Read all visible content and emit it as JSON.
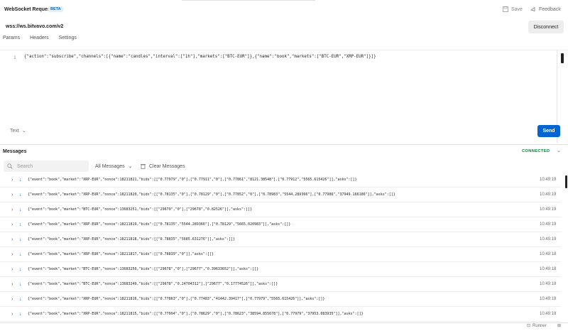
{
  "header": {
    "title": "WebSocket Request",
    "badge": "BETA",
    "save_label": "Save",
    "feedback_label": "Feedback"
  },
  "url_bar": {
    "url": "wss://ws.bitvavo.com/v2",
    "disconnect_label": "Disconnect"
  },
  "tabs": [
    {
      "label": "Params"
    },
    {
      "label": "Headers"
    },
    {
      "label": "Settings"
    }
  ],
  "editor": {
    "line_number": "1",
    "code": "{\"action\":\"subscribe\",\"channels\":[{\"name\":\"candles\",\"interval\":[\"1h\"],\"markets\":[\"BTC-EUR\"]},{\"name\":\"book\",\"markets\":[\"BTC-EUR\",\"XRP-EUR\"]}]}",
    "format_label": "Text",
    "send_label": "Send"
  },
  "messages_panel": {
    "title": "Messages",
    "status": "CONNECTED",
    "search_placeholder": "Search",
    "filter_label": "All Messages",
    "clear_label": "Clear Messages",
    "rows": [
      {
        "content": "{\"event\":\"book\",\"market\":\"XRP-EUR\",\"nonce\":18211821,\"bids\":[[\"0.77979\",\"0\"],[\"0.77911\",\"0\"],[\"0.77861\",\"8121.38548\"],[\"0.77912\",\"5565.615426\"]],\"asks\":[]}",
        "time": "10:49:19"
      },
      {
        "content": "{\"event\":\"book\",\"market\":\"XRP-EUR\",\"nonce\":18211820,\"bids\":[[\"0.78135\",\"0\"],[\"0.78129\",\"0\"],[\"0.77852\",\"0\"],[\"0.78983\",\"5544.289366\"],[\"0.77986\",\"37949.166186\"]],\"asks\":[]}",
        "time": "10:49:19"
      },
      {
        "content": "{\"event\":\"book\",\"market\":\"BTC-EUR\",\"nonce\":13683251,\"bids\":[[\"29679\",\"0\"],[\"29678\",\"0.82526\"]],\"asks\":[]}",
        "time": "10:49:19"
      },
      {
        "content": "{\"event\":\"book\",\"market\":\"XRP-EUR\",\"nonce\":18211819,\"bids\":[[\"0.78135\",\"5544.289366\"],[\"0.78129\",\"5665.020983\"]],\"asks\":[]}",
        "time": "10:49:19"
      },
      {
        "content": "{\"event\":\"book\",\"market\":\"XRP-EUR\",\"nonce\":18211818,\"bids\":[[\"0.78835\",\"5685.631276\"]],\"asks\":[]}",
        "time": "10:49:19"
      },
      {
        "content": "{\"event\":\"book\",\"market\":\"XRP-EUR\",\"nonce\":18211817,\"bids\":[[\"0.78839\",\"0\"]],\"asks\":[]}",
        "time": "10:49:18"
      },
      {
        "content": "{\"event\":\"book\",\"market\":\"BTC-EUR\",\"nonce\":13683250,\"bids\":[[\"29678\",\"0\"],[\"29677\",\"0.39633652\"]],\"asks\":[]}",
        "time": "10:49:18"
      },
      {
        "content": "{\"event\":\"book\",\"market\":\"BTC-EUR\",\"nonce\":13683249,\"bids\":[[\"29678\",\"0.24704312\"],[\"29677\",\"0.17774526\"]],\"asks\":[]}",
        "time": "10:49:18"
      },
      {
        "content": "{\"event\":\"book\",\"market\":\"XRP-EUR\",\"nonce\":18211816,\"bids\":[[\"0.77863\",\"0\"],[\"0.77483\",\"41442.39417\"],[\"0.77979\",\"5565.615426\"]],\"asks\":[]}",
        "time": "10:49:18"
      },
      {
        "content": "{\"event\":\"book\",\"market\":\"XRP-EUR\",\"nonce\":18211815,\"bids\":[[\"0.77994\",\"0\"],[\"0.78629\",\"0\"],[\"0.78623\",\"38594.855678\"],[\"0.77979\",\"37953.083935\"]],\"asks\":[]}",
        "time": "10:49:18"
      }
    ]
  },
  "statusbar": {
    "runner_label": "Runner"
  },
  "colors": {
    "accent": "#0265d2",
    "connected": "#0a7e3a"
  }
}
